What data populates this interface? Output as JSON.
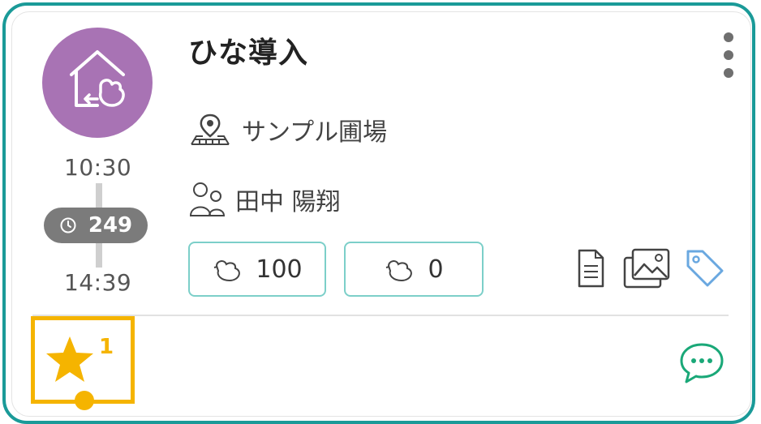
{
  "event": {
    "title": "ひな導入",
    "icon": "house-chick-icon",
    "start_time": "10:30",
    "end_time": "14:39",
    "duration": "249",
    "location": "サンプル圃場",
    "person": "田中 陽翔",
    "counts": [
      {
        "icon": "chick-icon",
        "value": "100"
      },
      {
        "icon": "chick-icon",
        "value": "0"
      }
    ],
    "attachments": [
      "document-icon",
      "image-gallery-icon",
      "tag-icon"
    ]
  },
  "footer": {
    "favorite_count": "1",
    "comment_icon": "chat-bubble-icon"
  },
  "colors": {
    "accent": "#1a9a98",
    "event_circle": "#a873b4",
    "favorite": "#f5b400",
    "comment": "#1aa878",
    "tag": "#6aa8e0",
    "duration_pill": "#7b7b7b"
  }
}
